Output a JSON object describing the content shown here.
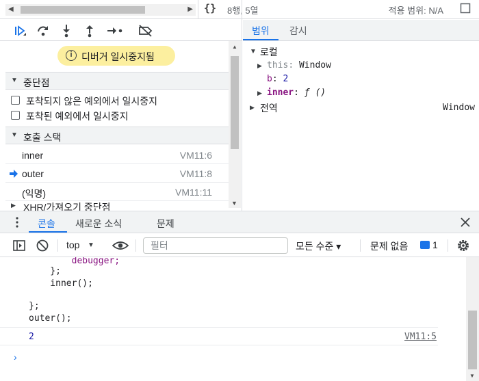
{
  "editor_status": {
    "cursor_position": "8행, 5열",
    "scope_range": "적용 범위: N/A"
  },
  "banner": {
    "text": "디버거 일시중지됨"
  },
  "breakpoints": {
    "header": "중단점",
    "options": [
      {
        "label": "포착되지 않은 예외에서 일시중지",
        "checked": false
      },
      {
        "label": "포착된 예외에서 일시중지",
        "checked": false
      }
    ]
  },
  "call_stack": {
    "header": "호출 스택",
    "frames": [
      {
        "name": "inner",
        "location": "VM11:6",
        "current": false
      },
      {
        "name": "outer",
        "location": "VM11:8",
        "current": true
      },
      {
        "name": "(익명)",
        "location": "VM11:11",
        "current": false
      }
    ],
    "next_section": "XHR/가져오기 중단점"
  },
  "scope_panel": {
    "tabs": [
      "범위",
      "감시"
    ],
    "active_tab": "범위",
    "local": {
      "label": "로컬",
      "this_key": "this",
      "this_value": "Window",
      "b_key": "b",
      "b_value": "2",
      "inner_key": "inner",
      "inner_value": "ƒ ()"
    },
    "global": {
      "label": "전역",
      "value": "Window"
    }
  },
  "drawer": {
    "tabs": [
      "콘솔",
      "새로운 소식",
      "문제"
    ],
    "active_tab": "콘솔"
  },
  "console_toolbar": {
    "context": "top",
    "filter_placeholder": "필터",
    "levels": "모든 수준 ▾",
    "issues_label": "문제 없음",
    "issues_count": "1"
  },
  "console": {
    "code_lines": [
      "        debugger;",
      "    };",
      "    inner();",
      "",
      "};",
      "outer();"
    ],
    "result_value": "2",
    "result_source": "VM11:5"
  },
  "colors": {
    "accent": "#1a73e8",
    "banner_bg": "#fcef9f",
    "keyword": "#881280",
    "number": "#1a1aa6"
  }
}
